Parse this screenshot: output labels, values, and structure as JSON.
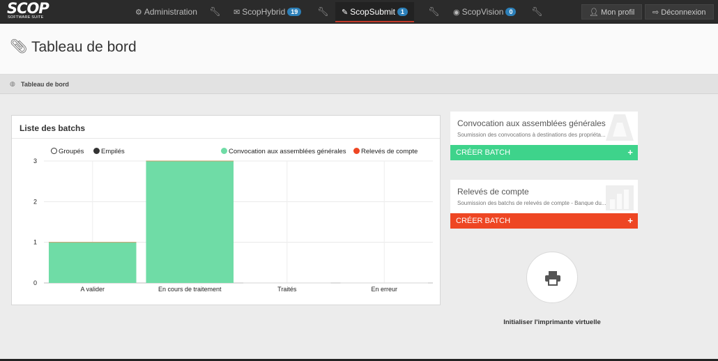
{
  "nav": {
    "logo_text": "SCOP",
    "logo_sub": "SOFTWARE SUITE",
    "items": [
      {
        "label": "Administration",
        "icon": "gear-icon"
      },
      {
        "label": "ScopHybrid",
        "icon": "envelope-icon",
        "badge": "19"
      },
      {
        "label": "ScopSubmit",
        "icon": "paperclip-icon",
        "badge": "1",
        "active": true
      },
      {
        "label": "ScopVision",
        "icon": "eye-icon",
        "badge": "0"
      }
    ],
    "profile_label": "Mon profil",
    "logout_label": "Déconnexion"
  },
  "page": {
    "title": "Tableau de bord",
    "breadcrumb": "Tableau de bord"
  },
  "chart_panel": {
    "title": "Liste des batchs",
    "legend_left": [
      "Groupés",
      "Empilés"
    ]
  },
  "chart_data": {
    "type": "bar",
    "stacked": true,
    "categories": [
      "A valider",
      "En cours de traitement",
      "Traités",
      "En erreur"
    ],
    "series": [
      {
        "name": "Convocation aux assemblées générales",
        "color": "#6fdca6",
        "values": [
          1,
          3,
          0,
          0
        ]
      },
      {
        "name": "Relevés de compte",
        "color": "#ee4623",
        "values": [
          0,
          0,
          0,
          0
        ]
      }
    ],
    "yticks": [
      0,
      1,
      2,
      3
    ],
    "ylim": [
      0,
      3
    ],
    "grid": true,
    "legend_position": "top"
  },
  "cards": [
    {
      "title": "Convocation aux assemblées générales",
      "description": "Soumission des convocations à destinations des propriéta...",
      "button_label": "CRÉER BATCH",
      "color": "#3ed38b",
      "icon": "megaphone-icon"
    },
    {
      "title": "Relevés de compte",
      "description": "Soumission des batchs de relevés de compte - Banque du...",
      "button_label": "CRÉER BATCH",
      "color": "#ee4623",
      "icon": "bar-chart-icon"
    }
  ],
  "printer": {
    "label": "Initialiser l'imprimante virtuelle"
  }
}
